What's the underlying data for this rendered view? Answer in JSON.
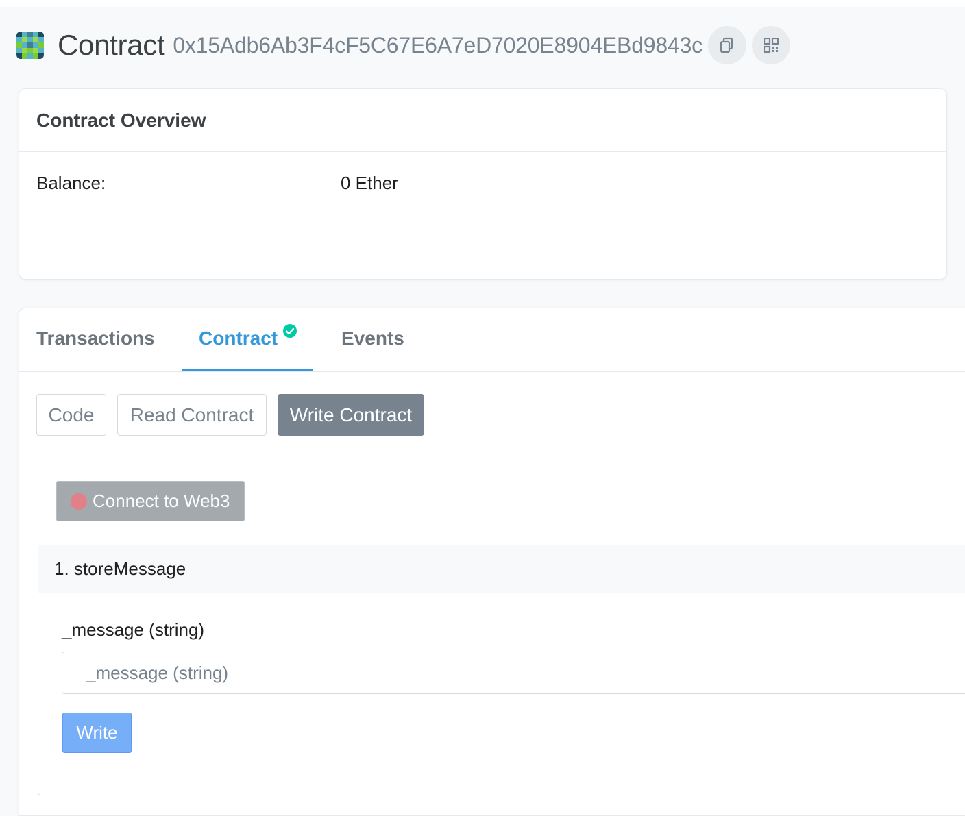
{
  "header": {
    "title": "Contract",
    "address": "0x15Adb6Ab3F4cF5C67E6A7eD7020E8904EBd9843c",
    "identicon_colors": [
      "#3f7f8f",
      "#55b4c6",
      "#7acb3a",
      "#1f4b5c",
      "#9bd84a"
    ],
    "icons": [
      "copy-icon",
      "qr-code-icon"
    ]
  },
  "overview": {
    "title": "Contract Overview",
    "balance_label": "Balance:",
    "balance_value": "0 Ether"
  },
  "tabs": [
    {
      "label": "Transactions",
      "active": false
    },
    {
      "label": "Contract",
      "active": true,
      "verified_icon": "check-circle-icon"
    },
    {
      "label": "Events",
      "active": false
    }
  ],
  "subtabs": [
    {
      "label": "Code",
      "active": false
    },
    {
      "label": "Read Contract",
      "active": false
    },
    {
      "label": "Write Contract",
      "active": true
    }
  ],
  "connect": {
    "label": "Connect to Web3",
    "status_color": "#e2808a"
  },
  "method": {
    "title": "1. storeMessage",
    "param_label": "_message (string)",
    "param_placeholder": "_message (string)",
    "param_value": "",
    "write_label": "Write"
  },
  "colors": {
    "accent": "#3498db",
    "verified": "#00c9a7"
  }
}
